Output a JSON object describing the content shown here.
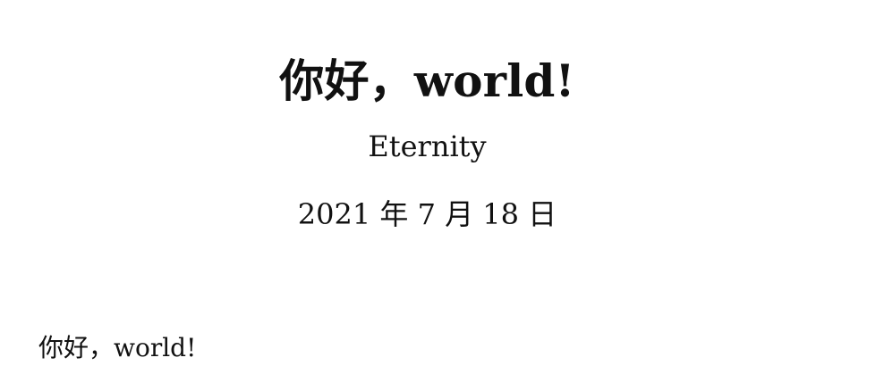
{
  "document": {
    "title": "你好，world!",
    "author": "Eternity",
    "date": "2021 年 7 月 18 日",
    "body_text": "你好，world!"
  }
}
